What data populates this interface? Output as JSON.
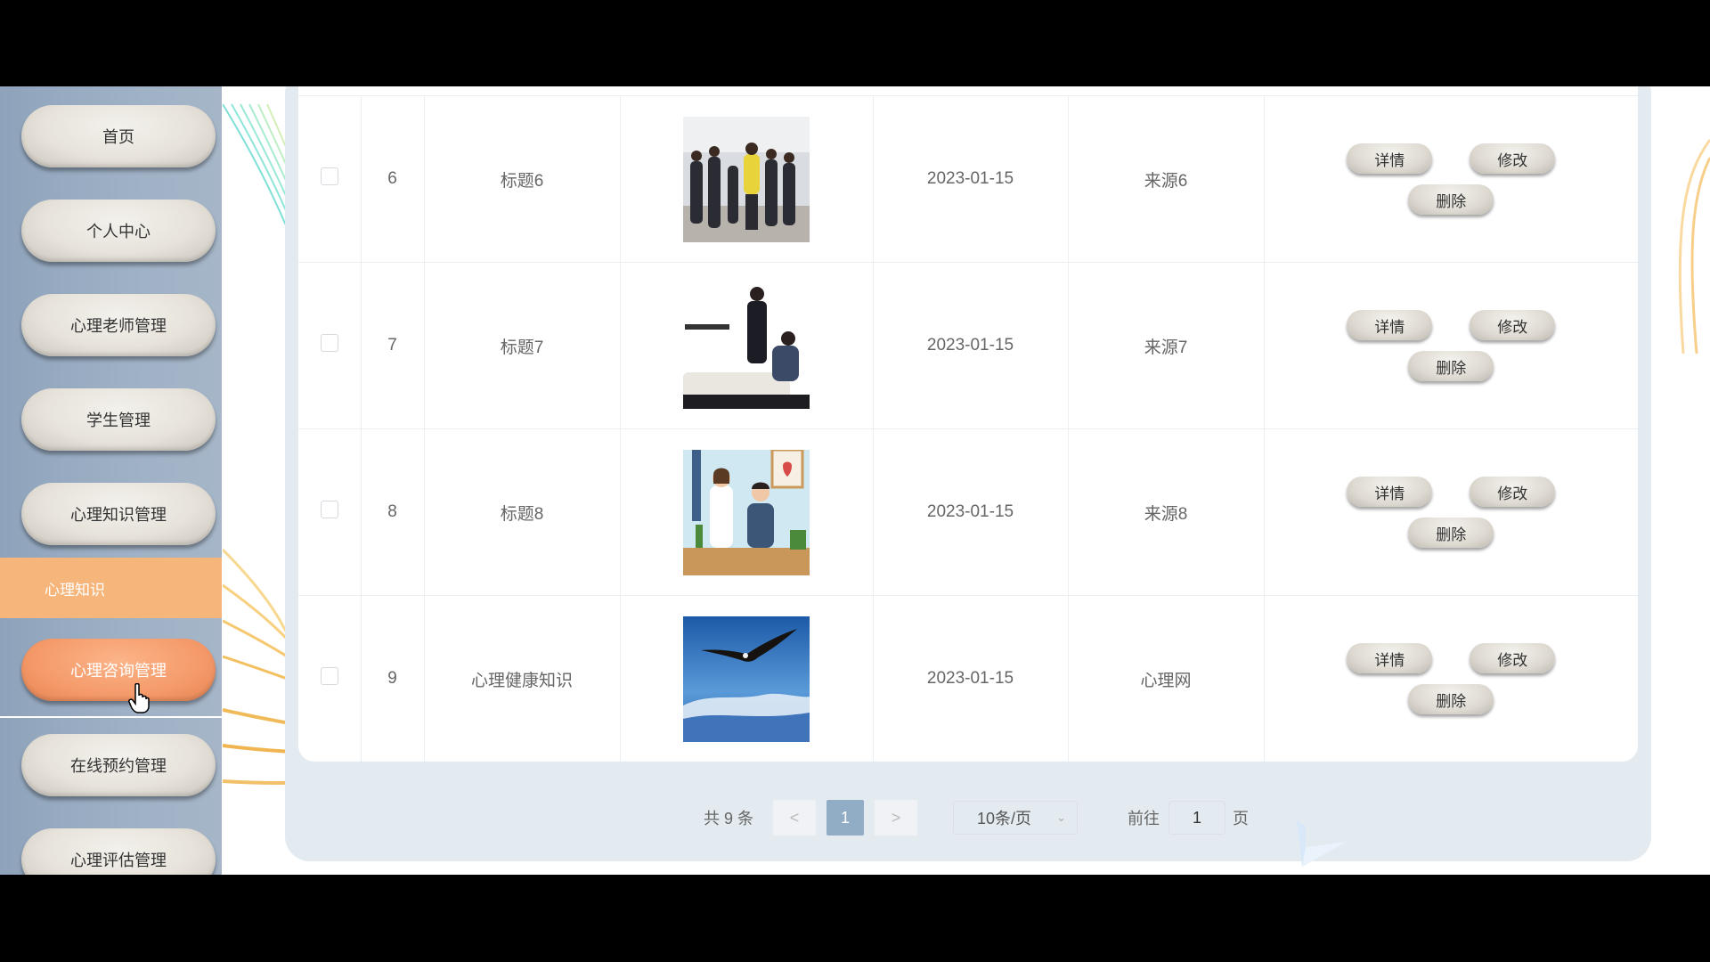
{
  "sidebar": {
    "items": [
      {
        "label": "首页"
      },
      {
        "label": "个人中心"
      },
      {
        "label": "心理老师管理"
      },
      {
        "label": "学生管理"
      },
      {
        "label": "心理知识管理"
      },
      {
        "label": "心理咨询管理"
      },
      {
        "label": "在线预约管理"
      },
      {
        "label": "心理评估管理"
      }
    ],
    "submenu_label": "心理知识",
    "active_item": "心理咨询管理"
  },
  "table": {
    "rows": [
      {
        "index": "6",
        "title": "标题6",
        "date": "2023-01-15",
        "source": "来源6",
        "image": "crowd-photo"
      },
      {
        "index": "7",
        "title": "标题7",
        "date": "2023-01-15",
        "source": "来源7",
        "image": "counseling-photo"
      },
      {
        "index": "8",
        "title": "标题8",
        "date": "2023-01-15",
        "source": "来源8",
        "image": "consultation-illustration"
      },
      {
        "index": "9",
        "title": "心理健康知识",
        "date": "2023-01-15",
        "source": "心理网",
        "image": "eagle-photo"
      }
    ],
    "actions": {
      "detail": "详情",
      "edit": "修改",
      "delete": "删除"
    }
  },
  "pagination": {
    "total": "共 9 条",
    "prev": "<",
    "current_page": "1",
    "next": ">",
    "page_size": "10条/页",
    "goto_label": "前往",
    "goto_value": "1",
    "page_suffix": "页"
  },
  "colors": {
    "sidebar_bg": "#9fb1c6",
    "active_accent": "#f59a6a",
    "submenu_bg": "#f6b57b",
    "page_active": "#91acc5"
  }
}
